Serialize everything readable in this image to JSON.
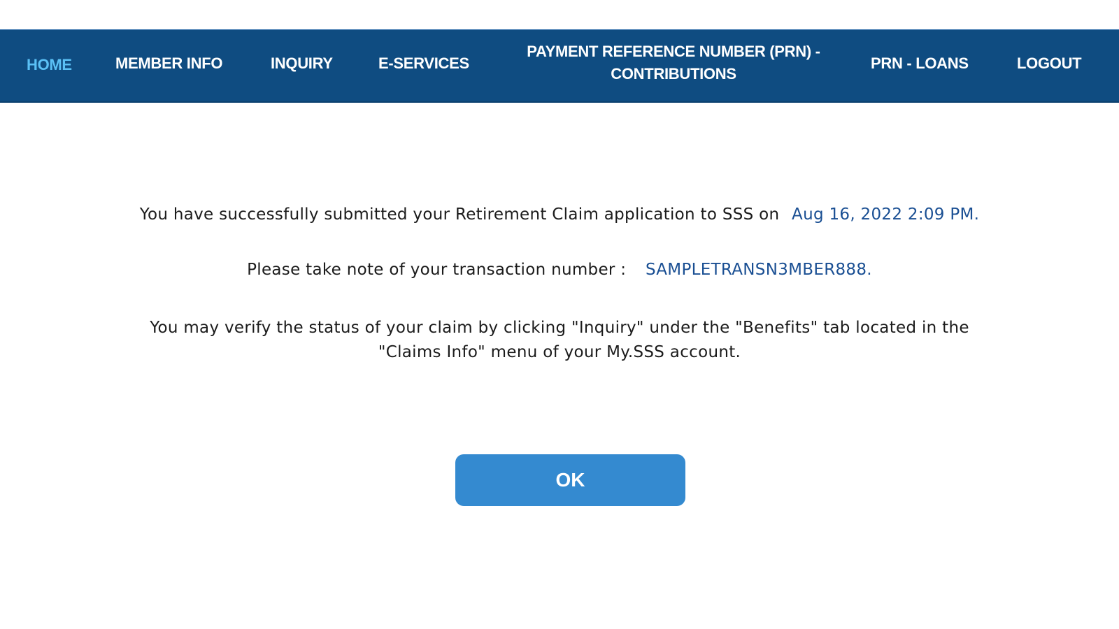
{
  "nav": {
    "items": [
      {
        "label": "HOME",
        "active": true
      },
      {
        "label": "MEMBER INFO"
      },
      {
        "label": "INQUIRY"
      },
      {
        "label": "E-SERVICES"
      },
      {
        "label_line1": "PAYMENT REFERENCE NUMBER (PRN) -",
        "label_line2": "CONTRIBUTIONS"
      },
      {
        "label": "PRN - LOANS"
      },
      {
        "label": "LOGOUT"
      }
    ]
  },
  "message": {
    "line1_text": "You have successfully submitted your Retirement Claim application to SSS on",
    "line1_date": "Aug 16, 2022 2:09 PM.",
    "line2_text": "Please take note of your transaction number :",
    "line2_txn": "SAMPLETRANSN3MBER888.",
    "line3a": "You may verify the status of your claim by clicking \"Inquiry\" under the \"Benefits\" tab located in the",
    "line3b": "\"Claims Info\" menu of your My.SSS account."
  },
  "ok_button": {
    "label": "OK"
  },
  "colors": {
    "nav_bg": "#0f4c81",
    "active_nav": "#5bc0f5",
    "highlight": "#1a4f93",
    "button": "#348ad0"
  }
}
